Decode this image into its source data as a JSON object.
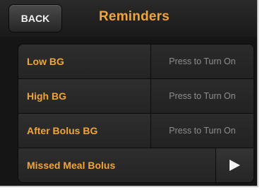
{
  "header": {
    "back_label": "BACK",
    "title": "Reminders"
  },
  "reminders": [
    {
      "label": "Low BG",
      "action": "Press to Turn On"
    },
    {
      "label": "High BG",
      "action": "Press to Turn On"
    },
    {
      "label": "After Bolus BG",
      "action": "Press to Turn On"
    },
    {
      "label": "Missed Meal Bolus",
      "action_icon": "chevron-right-icon"
    }
  ],
  "colors": {
    "accent": "#f0a43a",
    "background": "#151515",
    "muted_text": "#8e8e8e"
  }
}
